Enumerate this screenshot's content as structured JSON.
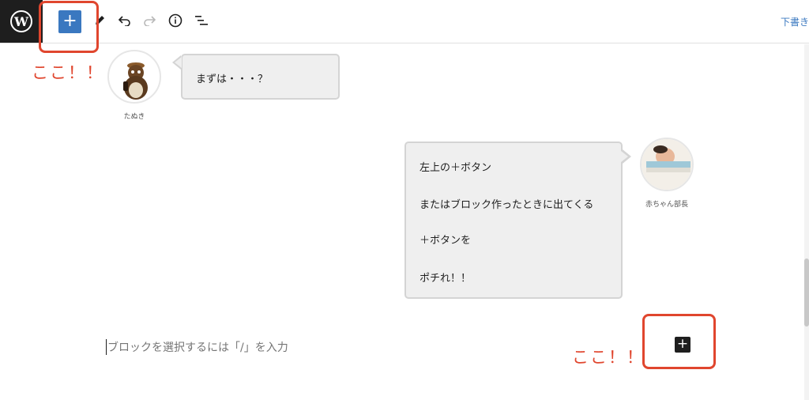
{
  "toolbar": {
    "add_block_label": "+",
    "draft_link": "下書き"
  },
  "annotations": {
    "top_label": "ここ！！",
    "bottom_label": "ここ！！",
    "accent_color": "#e0462e"
  },
  "chat": [
    {
      "speaker": "たぬき",
      "side": "left",
      "lines": [
        "まずは・・・？"
      ]
    },
    {
      "speaker": "赤ちゃん部長",
      "side": "right",
      "lines": [
        "左上の＋ボタン",
        "またはブロック作ったときに出てくる",
        "＋ボタンを",
        "ポチれ！！"
      ]
    }
  ],
  "editor": {
    "placeholder": "ブロックを選択するには「/」を入力",
    "inserter_label": "+"
  },
  "colors": {
    "primary": "#3a78c0",
    "dark": "#1e1e1e",
    "bubble_bg": "#efefef"
  },
  "icons": [
    "wordpress-logo-icon",
    "plus-icon",
    "pencil-icon",
    "undo-icon",
    "redo-icon",
    "info-icon",
    "list-view-icon"
  ]
}
